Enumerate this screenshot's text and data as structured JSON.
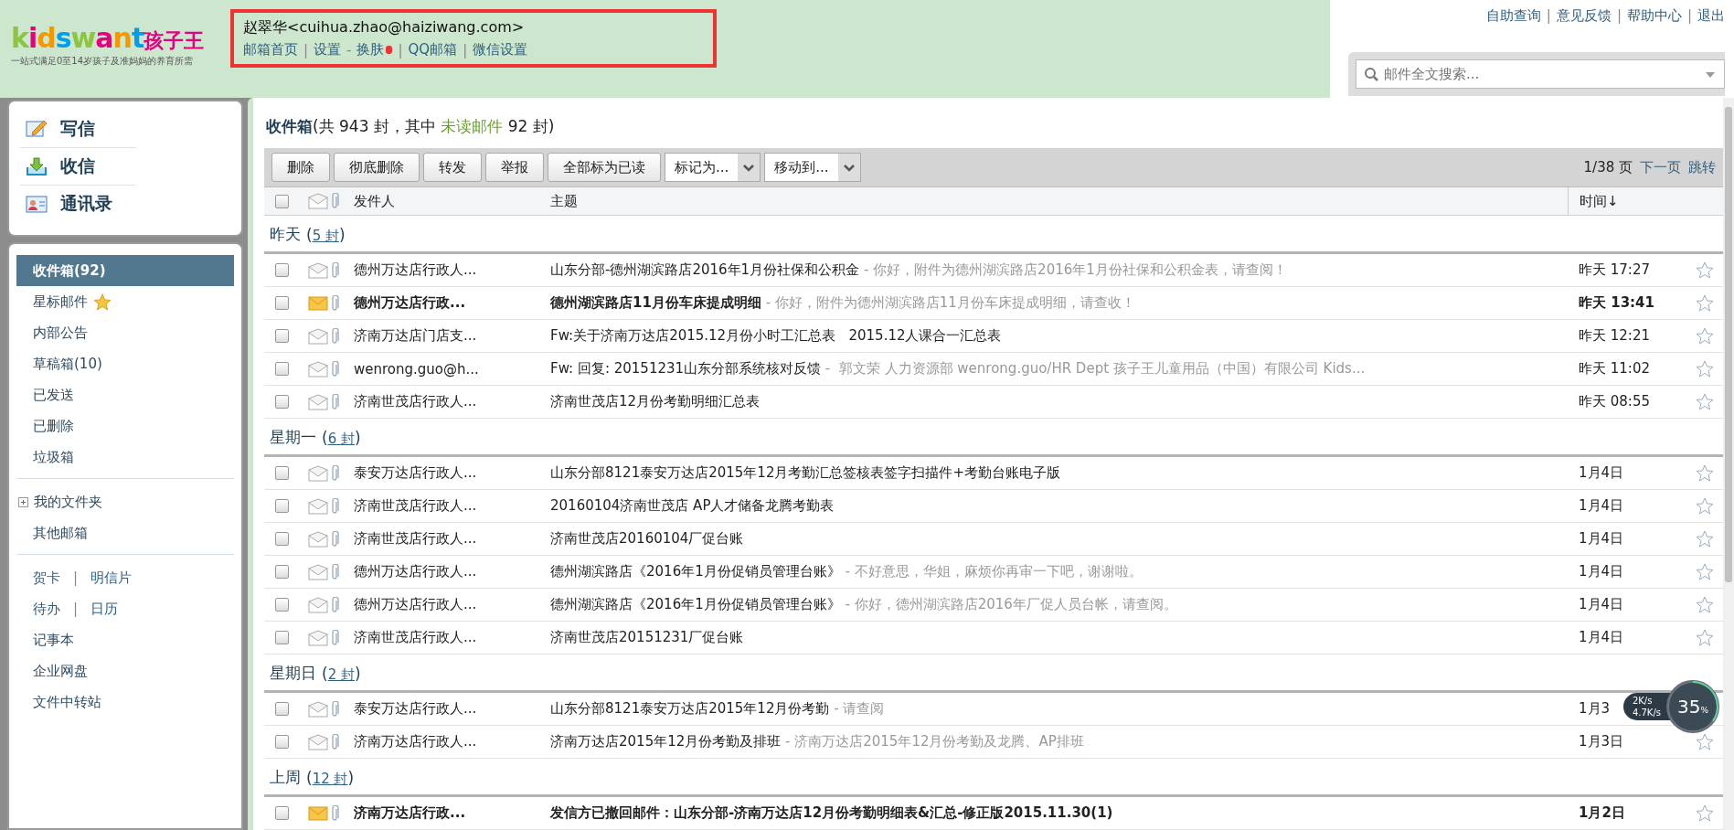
{
  "header": {
    "logo": {
      "wordmark": "kidswant",
      "brand": "孩子王",
      "tagline": "一站式满足0至14岁孩子及准妈妈的养育所需"
    },
    "user": {
      "name": "赵翠华<cuihua.zhao@haiziwang.com>",
      "highlighted": true
    },
    "nav_links": [
      {
        "label": "邮箱首页"
      },
      {
        "sep": "|",
        "label": "设置"
      },
      {
        "sep": "-",
        "label": "换肤",
        "dot": true
      },
      {
        "sep": "|",
        "label": "QQ邮箱"
      },
      {
        "sep": "|",
        "label": "微信设置"
      }
    ],
    "top_links": [
      {
        "label": "自助查询"
      },
      {
        "sep": "|",
        "label": "意见反馈"
      },
      {
        "sep": "|",
        "label": "帮助中心"
      },
      {
        "sep": "|",
        "label": "退出"
      }
    ],
    "search": {
      "placeholder": "邮件全文搜索..."
    }
  },
  "sidebar": {
    "actions": [
      {
        "label": "写信"
      },
      {
        "label": "收信"
      },
      {
        "label": "通讯录"
      }
    ],
    "sections": [
      [
        {
          "kind": "folder",
          "label": "收件箱(92)",
          "selected": true
        },
        {
          "kind": "starred",
          "label": "星标邮件",
          "selected": false
        },
        {
          "kind": "folder",
          "label": "内部公告",
          "selected": false
        },
        {
          "kind": "folder",
          "label": "草稿箱(10)",
          "selected": false
        },
        {
          "kind": "folder",
          "label": "已发送",
          "selected": false
        },
        {
          "kind": "folder",
          "label": "已删除",
          "selected": false
        },
        {
          "kind": "folder",
          "label": "垃圾箱",
          "selected": false
        }
      ],
      [
        {
          "kind": "expandable",
          "label": "我的文件夹",
          "selected": false
        },
        {
          "kind": "folder",
          "label": "其他邮箱",
          "selected": false
        }
      ],
      [
        {
          "kind": "pair",
          "labels": [
            "贺卡",
            "明信片"
          ],
          "sep": "|"
        },
        {
          "kind": "pair",
          "labels": [
            "待办",
            "日历"
          ],
          "sep": "|"
        },
        {
          "kind": "folder",
          "label": "记事本",
          "selected": false
        },
        {
          "kind": "folder",
          "label": "企业网盘",
          "selected": false
        },
        {
          "kind": "folder",
          "label": "文件中转站",
          "selected": false
        }
      ]
    ]
  },
  "mailbox": {
    "title": "收件箱",
    "count_prefix": "(共 943 封，其中 ",
    "unread_link": "未读邮件",
    "count_suffix": " 92 封)",
    "buttons": [
      "删除",
      "彻底删除",
      "转发",
      "举报",
      "全部标为已读"
    ],
    "dropdowns": [
      "标记为...",
      "移动到..."
    ],
    "pager": {
      "page": "1/38 页",
      "next": "下一页",
      "jump": "跳转"
    },
    "select_all": {
      "checked": false
    },
    "columns": [
      "发件人",
      "主题",
      "时间↓"
    ],
    "groups": [
      {
        "label": "昨天",
        "open": "(",
        "count": "5 封",
        "close": ")",
        "rows": [
          {
            "sender": "德州万达店行政人...",
            "subject": "山东分部-德州湖滨路店2016年1月份社保和公积金",
            "preview": " - 你好，附件为德州湖滨路店2016年1月份社保和公积金表，请查阅！",
            "time": "昨天 17:27",
            "unread": false,
            "checked": false,
            "starred": false
          },
          {
            "sender": "德州万达店行政...",
            "subject": "德州湖滨路店11月份车床提成明细",
            "preview": " - 你好，附件为德州湖滨路店11月份车床提成明细，请查收！",
            "time": "昨天 13:41",
            "unread": true,
            "checked": false,
            "starred": false
          },
          {
            "sender": "济南万达店门店支...",
            "subject": "Fw:关于济南万达店2015.12月份小时工汇总表   2015.12人课合一汇总表",
            "time": "昨天 12:21",
            "unread": false,
            "checked": false,
            "starred": false
          },
          {
            "sender": "wenrong.guo@h...",
            "subject": "Fw: 回复: 20151231山东分部系统核对反馈",
            "preview": " -  郭文荣 人力资源部 wenrong.guo/HR Dept 孩子王儿童用品（中国）有限公司 Kids...",
            "time": "昨天 11:02",
            "unread": false,
            "checked": false,
            "starred": false
          },
          {
            "sender": "济南世茂店行政人...",
            "subject": "济南世茂店12月份考勤明细汇总表",
            "time": "昨天 08:55",
            "unread": false,
            "checked": false,
            "starred": false
          }
        ]
      },
      {
        "label": "星期一",
        "open": "(",
        "count": "6 封",
        "close": ")",
        "rows": [
          {
            "sender": "泰安万达店行政人...",
            "subject": "山东分部8121泰安万达店2015年12月考勤汇总签核表签字扫描件+考勤台账电子版",
            "time": "1月4日",
            "unread": false,
            "checked": false,
            "starred": false
          },
          {
            "sender": "济南世茂店行政人...",
            "subject": "20160104济南世茂店 AP人才储备龙腾考勤表",
            "time": "1月4日",
            "unread": false,
            "checked": false,
            "starred": false
          },
          {
            "sender": "济南世茂店行政人...",
            "subject": "济南世茂店20160104厂促台账",
            "time": "1月4日",
            "unread": false,
            "checked": false,
            "starred": false
          },
          {
            "sender": "德州万达店行政人...",
            "subject": "德州湖滨路店《2016年1月份促销员管理台账》",
            "preview": " - 不好意思，华姐，麻烦你再审一下吧，谢谢啦。",
            "time": "1月4日",
            "unread": false,
            "checked": false,
            "starred": false
          },
          {
            "sender": "德州万达店行政人...",
            "subject": "德州湖滨路店《2016年1月份促销员管理台账》",
            "preview": " - 你好，德州湖滨路店2016年厂促人员台帐，请查阅。",
            "time": "1月4日",
            "unread": false,
            "checked": false,
            "starred": false
          },
          {
            "sender": "济南世茂店行政人...",
            "subject": "济南世茂店20151231厂促台账",
            "time": "1月4日",
            "unread": false,
            "checked": false,
            "starred": false
          }
        ]
      },
      {
        "label": "星期日",
        "open": "(",
        "count": "2 封",
        "close": ")",
        "rows": [
          {
            "sender": "泰安万达店行政人...",
            "subject": "山东分部8121泰安万达店2015年12月份考勤",
            "preview": " - 请查阅",
            "time": "1月3",
            "unread": false,
            "checked": false
          },
          {
            "sender": "济南万达店行政人...",
            "subject": "济南万达店2015年12月份考勤及排班",
            "preview": " - 济南万达店2015年12月份考勤及龙腾、AP排班",
            "time": "1月3日",
            "unread": false,
            "checked": false,
            "starred": false
          }
        ]
      },
      {
        "label": "上周",
        "open": "(",
        "count": "12 封",
        "close": ")",
        "rows": [
          {
            "sender": "济南万达店行政...",
            "subject": "发信方已撤回邮件：山东分部-济南万达店12月份考勤明细表&汇总-修正版2015.11.30(1)",
            "time": "1月2日",
            "unread": true,
            "checked": false,
            "starred": false
          }
        ]
      }
    ]
  },
  "speed_widget": {
    "up": "2K/s",
    "down": "4.7K/s",
    "percent": "35",
    "unit": "%"
  }
}
